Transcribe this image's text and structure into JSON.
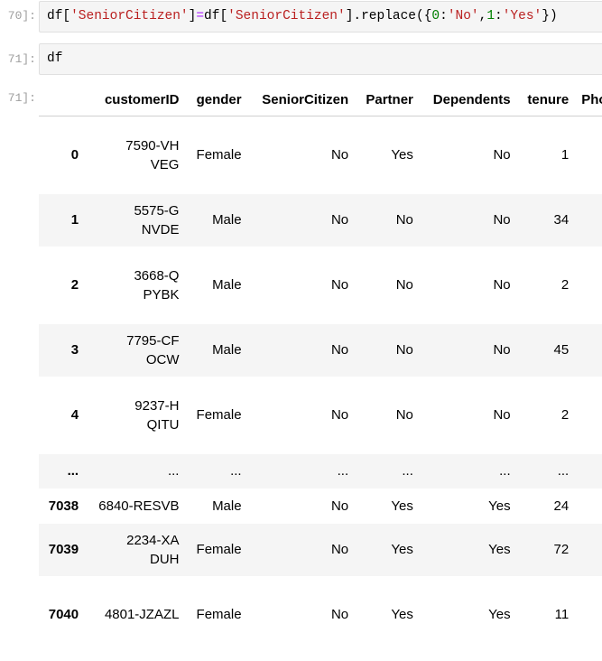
{
  "cells": [
    {
      "prompt": "70]:",
      "code_tokens": [
        {
          "t": "df[",
          "c": "txt"
        },
        {
          "t": "'SeniorCitizen'",
          "c": "str"
        },
        {
          "t": "]",
          "c": "txt"
        },
        {
          "t": "=",
          "c": "op"
        },
        {
          "t": "df[",
          "c": "txt"
        },
        {
          "t": "'SeniorCitizen'",
          "c": "str"
        },
        {
          "t": "].replace({",
          "c": "txt"
        },
        {
          "t": "0",
          "c": "num"
        },
        {
          "t": ":",
          "c": "txt"
        },
        {
          "t": "'No'",
          "c": "str"
        },
        {
          "t": ",",
          "c": "txt"
        },
        {
          "t": "1",
          "c": "num"
        },
        {
          "t": ":",
          "c": "txt"
        },
        {
          "t": "'Yes'",
          "c": "str"
        },
        {
          "t": "})",
          "c": "txt"
        }
      ]
    },
    {
      "prompt": "71]:",
      "code": "df"
    }
  ],
  "output_prompt": "71]:",
  "table": {
    "columns": [
      "",
      "customerID",
      "gender",
      "SeniorCitizen",
      "Partner",
      "Dependents",
      "tenure",
      "Pho"
    ],
    "rows": [
      {
        "index": "0",
        "cells": [
          "7590-VHVEG",
          "Female",
          "No",
          "Yes",
          "No",
          "1",
          ""
        ]
      },
      {
        "index": "1",
        "cells": [
          "5575-GNVDE",
          "Male",
          "No",
          "No",
          "No",
          "34",
          ""
        ]
      },
      {
        "index": "2",
        "cells": [
          "3668-QPYBK",
          "Male",
          "No",
          "No",
          "No",
          "2",
          ""
        ]
      },
      {
        "index": "3",
        "cells": [
          "7795-CFOCW",
          "Male",
          "No",
          "No",
          "No",
          "45",
          ""
        ]
      },
      {
        "index": "4",
        "cells": [
          "9237-HQITU",
          "Female",
          "No",
          "No",
          "No",
          "2",
          ""
        ]
      },
      {
        "index": "...",
        "cells": [
          "...",
          "...",
          "...",
          "...",
          "...",
          "...",
          ""
        ]
      },
      {
        "index": "7038",
        "cells": [
          "6840-RESVB",
          "Male",
          "No",
          "Yes",
          "Yes",
          "24",
          ""
        ]
      },
      {
        "index": "7039",
        "cells": [
          "2234-XADUH",
          "Female",
          "No",
          "Yes",
          "Yes",
          "72",
          ""
        ]
      },
      {
        "index": "7040",
        "cells": [
          "4801-JZAZL",
          "Female",
          "No",
          "Yes",
          "Yes",
          "11",
          ""
        ]
      }
    ]
  }
}
